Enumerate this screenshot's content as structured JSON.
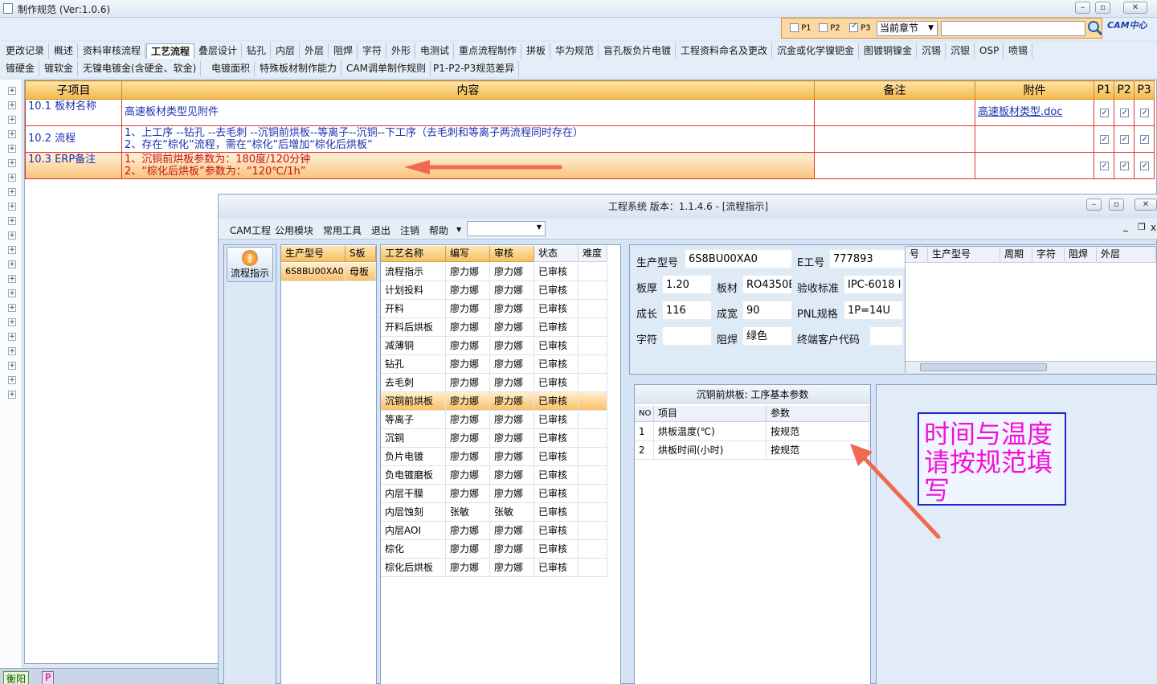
{
  "window": {
    "title": "制作规范 (Ver:1.0.6)"
  },
  "filter": {
    "p1": "P1",
    "p2": "P2",
    "p3": "P3",
    "p1_checked": false,
    "p2_checked": false,
    "p3_checked": true,
    "scope": "当前章节",
    "search_placeholder": "",
    "logo": "CAM中心"
  },
  "tabs_row1": [
    "更改记录",
    "概述",
    "资料审核流程",
    "工艺流程",
    "叠层设计",
    "钻孔",
    "内层",
    "外层",
    "阻焊",
    "字符",
    "外形",
    "电测试",
    "重点流程制作",
    "拼板",
    "华为规范",
    "盲孔板负片电镀",
    "工程资料命名及更改",
    "沉金或化学镍钯金",
    "图镀铜镍金",
    "沉锡",
    "沉银",
    "OSP",
    "喷锡"
  ],
  "tabs_row2": [
    "镀硬金",
    "镀软金",
    "无镍电镀金(含硬金、软金)",
    "电镀面积",
    "特殊板材制作能力",
    "CAM调单制作规则",
    "P1-P2-P3规范差异"
  ],
  "active_tab": "工艺流程",
  "table": {
    "headers": [
      "子项目",
      "内容",
      "备注",
      "附件",
      "P1",
      "P2",
      "P3"
    ],
    "rows": [
      {
        "sub": "10.1 板材名称",
        "content1": "高速板材类型见附件",
        "content2": "",
        "note": "",
        "attach": "高速板材类型.doc"
      },
      {
        "sub": "10.2 流程",
        "content1": "1、上工序 --钻孔 --去毛刺 --沉铜前烘板--等离子--沉铜--下工序（去毛刺和等离子两流程同时存在）",
        "content2": "2、存在“棕化”流程，需在“棕化”后增加“棕化后烘板”",
        "note": "",
        "attach": ""
      },
      {
        "sub": "10.3 ERP备注",
        "content1": "1、沉铜前烘板参数为：180度/120分钟",
        "content2": "2、“棕化后烘板”参数为：“120℃/1h”",
        "note": "",
        "attach": ""
      }
    ]
  },
  "taskbar": {
    "item1": "衡阳",
    "item2": "P"
  },
  "sub": {
    "title": "工程系统  版本：1.1.4.6 - [流程指示]",
    "menu": [
      "CAM工程",
      "公用模块",
      "常用工具",
      "退出",
      "注销",
      "帮助"
    ],
    "side_button": "流程指示",
    "model_headers": [
      "生产型号",
      "S板"
    ],
    "model_rows": [
      [
        "6S8BU00XA0",
        "母板"
      ]
    ],
    "proc_headers": [
      "工艺名称",
      "编写",
      "审核",
      "状态",
      "难度"
    ],
    "proc_rows": [
      [
        "流程指示",
        "廖力娜",
        "廖力娜",
        "已审核",
        ""
      ],
      [
        "计划投料",
        "廖力娜",
        "廖力娜",
        "已审核",
        ""
      ],
      [
        "开料",
        "廖力娜",
        "廖力娜",
        "已审核",
        ""
      ],
      [
        "开料后烘板",
        "廖力娜",
        "廖力娜",
        "已审核",
        ""
      ],
      [
        "减薄铜",
        "廖力娜",
        "廖力娜",
        "已审核",
        ""
      ],
      [
        "钻孔",
        "廖力娜",
        "廖力娜",
        "已审核",
        ""
      ],
      [
        "去毛刺",
        "廖力娜",
        "廖力娜",
        "已审核",
        ""
      ],
      [
        "沉铜前烘板",
        "廖力娜",
        "廖力娜",
        "已审核",
        ""
      ],
      [
        "等离子",
        "廖力娜",
        "廖力娜",
        "已审核",
        ""
      ],
      [
        "沉铜",
        "廖力娜",
        "廖力娜",
        "已审核",
        ""
      ],
      [
        "负片电镀",
        "廖力娜",
        "廖力娜",
        "已审核",
        ""
      ],
      [
        "负电镀磨板",
        "廖力娜",
        "廖力娜",
        "已审核",
        ""
      ],
      [
        "内层干膜",
        "廖力娜",
        "廖力娜",
        "已审核",
        ""
      ],
      [
        "内层蚀刻",
        "张敏",
        "张敏",
        "已审核",
        ""
      ],
      [
        "内层AOI",
        "廖力娜",
        "廖力娜",
        "已审核",
        ""
      ],
      [
        "棕化",
        "廖力娜",
        "廖力娜",
        "已审核",
        ""
      ],
      [
        "棕化后烘板",
        "廖力娜",
        "廖力娜",
        "已审核",
        ""
      ]
    ],
    "selected_proc": "沉铜前烘板",
    "info": {
      "prod_label": "生产型号",
      "prod": "6S8BU00XA0",
      "e_label": "E工号",
      "e": "777893",
      "thick_label": "板厚",
      "thick": "1.20",
      "mat_label": "板材",
      "mat": "RO4350B",
      "std_label": "验收标准",
      "std": "IPC-6018 I",
      "len_label": "成长",
      "len": "116",
      "wid_label": "成宽",
      "wid": "90",
      "pnl_label": "PNL规格",
      "pnl": "1P=14U",
      "char_label": "字符",
      "char": "",
      "mask_label": "阻焊",
      "mask": "绿色",
      "cust_label": "终端客户代码",
      "cust": ""
    },
    "right_headers": [
      "号",
      "生产型号",
      "周期",
      "字符",
      "阻焊",
      "外层"
    ],
    "param_title": "沉铜前烘板: 工序基本参数",
    "param_headers": [
      "NO",
      "项目",
      "参数"
    ],
    "params": [
      [
        "1",
        "烘板温度(℃)",
        "按规范"
      ],
      [
        "2",
        "烘板时间(小时)",
        "按规范"
      ]
    ],
    "annotation": "时间与温度请按规范填写"
  },
  "colors": {
    "accent": "#f5b84a",
    "border_red": "#e03333",
    "link": "#1a2fb0",
    "annotation": "#f20fd8",
    "arrow": "#f06a52"
  }
}
